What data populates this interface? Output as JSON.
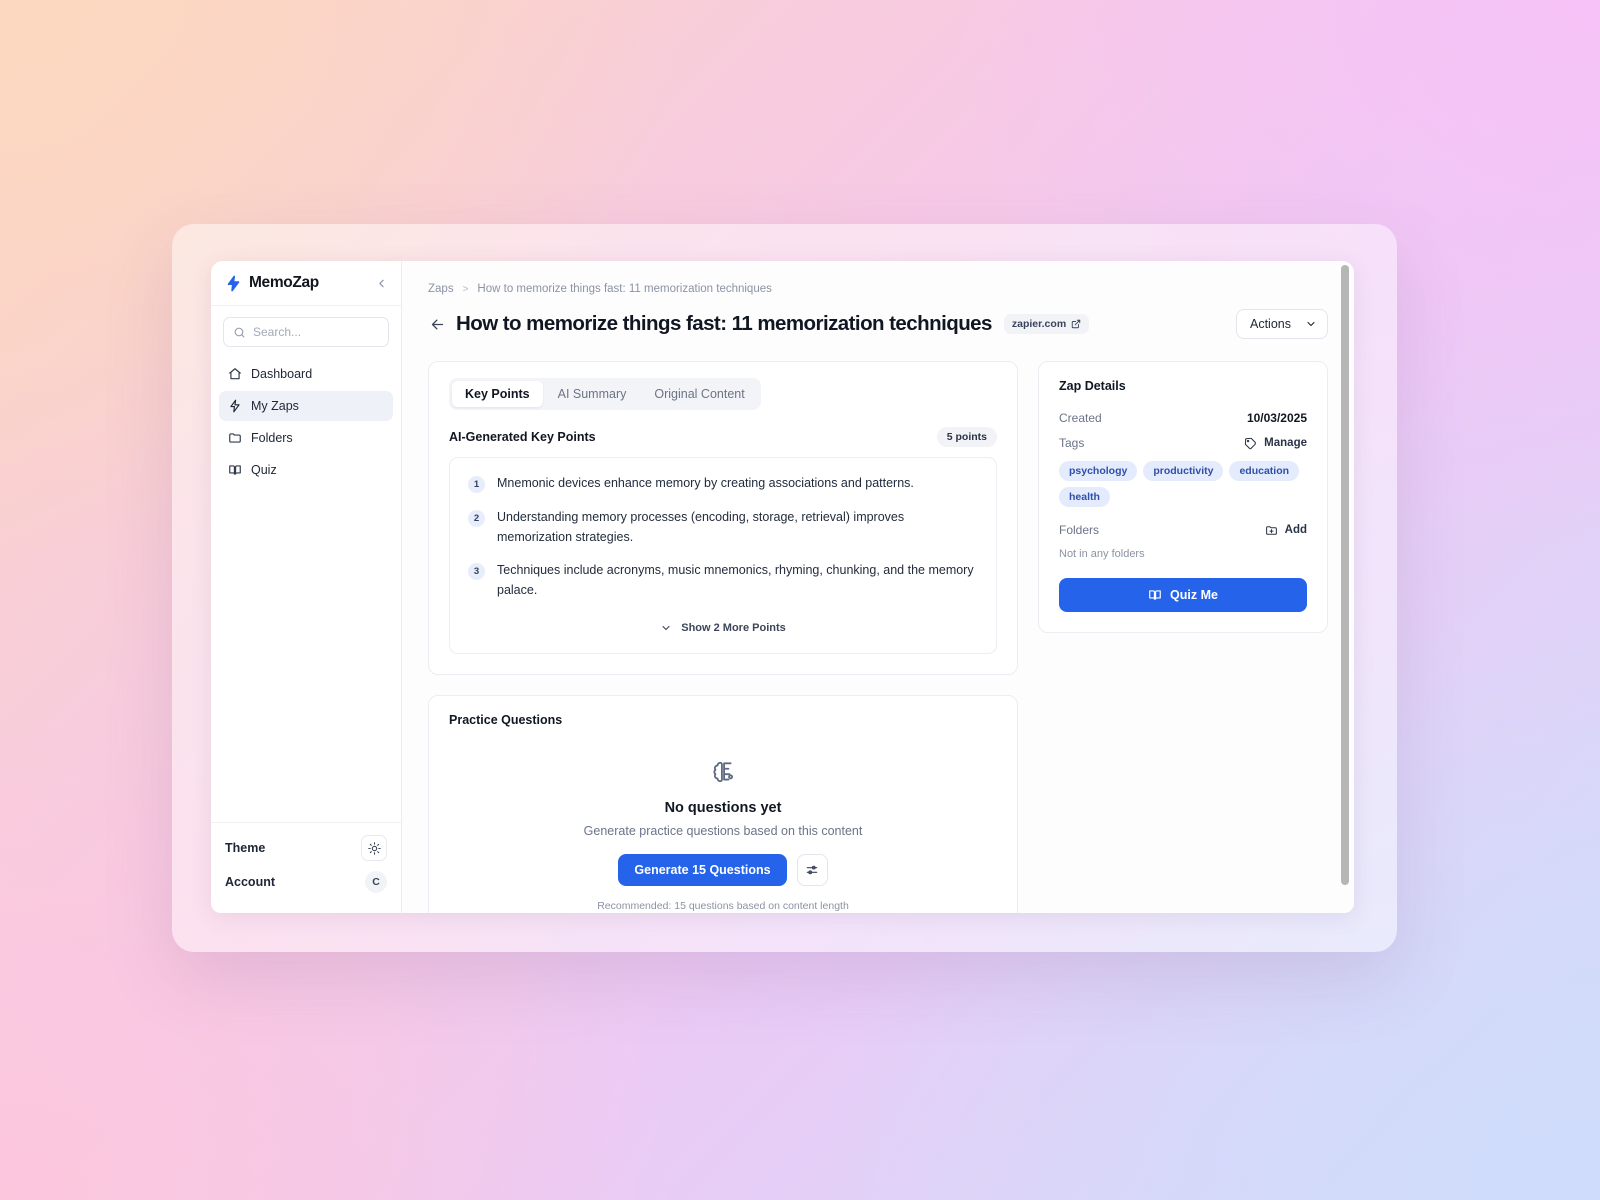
{
  "sidebar": {
    "brand": "MemoZap",
    "collapse_icon": "chevron-left-icon",
    "search": {
      "value": "",
      "placeholder": "Search...",
      "icon": "search-icon"
    },
    "items": [
      {
        "label": "Dashboard",
        "icon": "home-icon",
        "active": false
      },
      {
        "label": "My Zaps",
        "icon": "zap-icon",
        "active": true
      },
      {
        "label": "Folders",
        "icon": "folder-icon",
        "active": false
      },
      {
        "label": "Quiz",
        "icon": "book-open-icon",
        "active": false
      }
    ],
    "footer": {
      "theme_label": "Theme",
      "theme_icon": "sun-icon",
      "account_label": "Account",
      "avatar_initial": "C"
    }
  },
  "header": {
    "breadcrumb_root": "Zaps",
    "breadcrumb_separator": ">",
    "breadcrumb_current": "How to memorize things fast: 11 memorization techniques",
    "back_icon": "arrow-left-icon",
    "title": "How to memorize things fast: 11 memorization techniques",
    "source_chip": "zapier.com",
    "source_chip_icon": "external-link-icon",
    "actions_label": "Actions",
    "actions_icon": "chevron-down-icon"
  },
  "content": {
    "tabs": [
      {
        "label": "Key Points",
        "active": true
      },
      {
        "label": "AI Summary",
        "active": false
      },
      {
        "label": "Original Content",
        "active": false
      }
    ],
    "key_points_title": "AI-Generated Key Points",
    "points_badge": "5 points",
    "key_points": [
      {
        "num": "1",
        "text": "Mnemonic devices enhance memory by creating associations and patterns."
      },
      {
        "num": "2",
        "text": "Understanding memory processes (encoding, storage, retrieval) improves memorization strategies."
      },
      {
        "num": "3",
        "text": "Techniques include acronyms, music mnemonics, rhyming, chunking, and the memory palace."
      }
    ],
    "show_more_label": "Show 2 More Points",
    "show_more_icon": "chevron-down-icon"
  },
  "practice": {
    "title": "Practice Questions",
    "empty_icon": "brain-icon",
    "empty_heading": "No questions yet",
    "empty_sub": "Generate practice questions based on this content",
    "generate_label": "Generate 15 Questions",
    "settings_icon": "sliders-icon",
    "note": "Recommended: 15 questions based on content length"
  },
  "details": {
    "title": "Zap Details",
    "created_label": "Created",
    "created_value": "10/03/2025",
    "tags_label": "Tags",
    "manage_label": "Manage",
    "manage_icon": "tag-icon",
    "tags": [
      "psychology",
      "productivity",
      "education",
      "health"
    ],
    "folders_label": "Folders",
    "add_label": "Add",
    "add_icon": "folder-plus-icon",
    "folders_empty": "Not in any folders",
    "quiz_label": "Quiz Me",
    "quiz_icon": "book-open-icon"
  },
  "colors": {
    "accent": "#2563eb",
    "tag_bg": "#e3ebfd",
    "tag_text": "#2f4fa8",
    "muted": "#8b93a3"
  }
}
